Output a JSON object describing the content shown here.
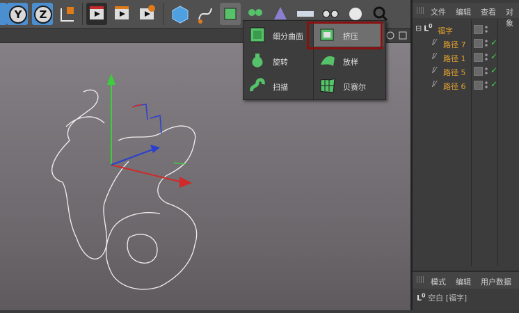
{
  "toolbar": {
    "axis_y": "Y",
    "axis_z": "Z"
  },
  "popup": {
    "items": [
      "细分曲面",
      "挤压",
      "旋转",
      "放样",
      "扫描",
      "贝赛尔"
    ]
  },
  "objects": {
    "title": "文件",
    "edit": "编辑",
    "view": "查看",
    "obj": "对象",
    "root": "福字",
    "children": [
      "路径 7",
      "路径 1",
      "路径 5",
      "路径 6"
    ]
  },
  "attributes": {
    "mode": "模式",
    "edit": "编辑",
    "userdata": "用户数据",
    "empty": "空白 [福字]"
  },
  "colors": {
    "accent_blue": "#4b8fd0",
    "highlight_red": "#8b1010",
    "check_green": "#3fd24a",
    "object_orange": "#e0a030"
  }
}
